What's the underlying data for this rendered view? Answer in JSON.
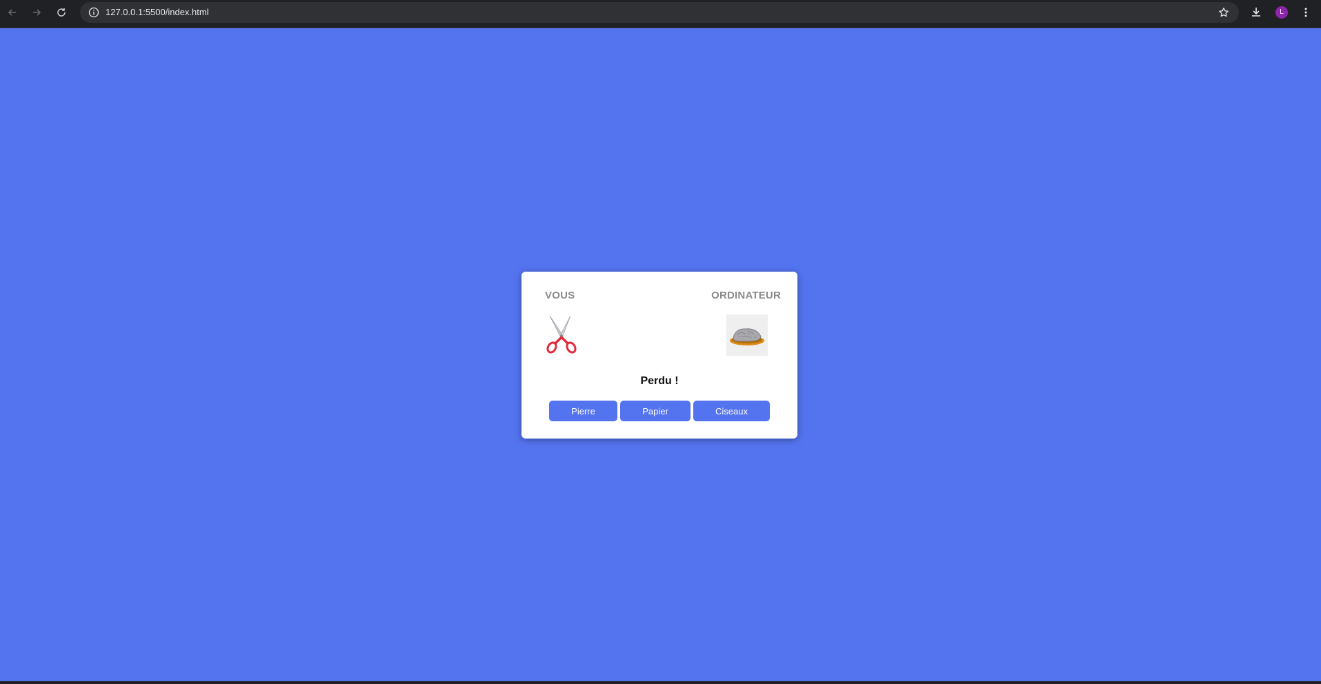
{
  "browser": {
    "url": "127.0.0.1:5500/index.html",
    "profile_initial": "L",
    "icons": {
      "back": "back-arrow-icon",
      "forward": "forward-arrow-icon",
      "reload": "reload-icon",
      "info": "info-icon",
      "bookmark": "star-icon",
      "download": "download-icon",
      "menu": "more-vert-icon"
    }
  },
  "game": {
    "player_label": "VOUS",
    "computer_label": "ORDINATEUR",
    "player_choice_icon": "scissors-icon",
    "computer_choice_icon": "rock-icon",
    "result": "Perdu !",
    "buttons": {
      "rock": "Pierre",
      "paper": "Papier",
      "scissors": "Ciseaux"
    }
  },
  "colors": {
    "background": "#5473ef",
    "button": "#5473ef",
    "card": "#ffffff",
    "label": "#8a8a8a"
  }
}
